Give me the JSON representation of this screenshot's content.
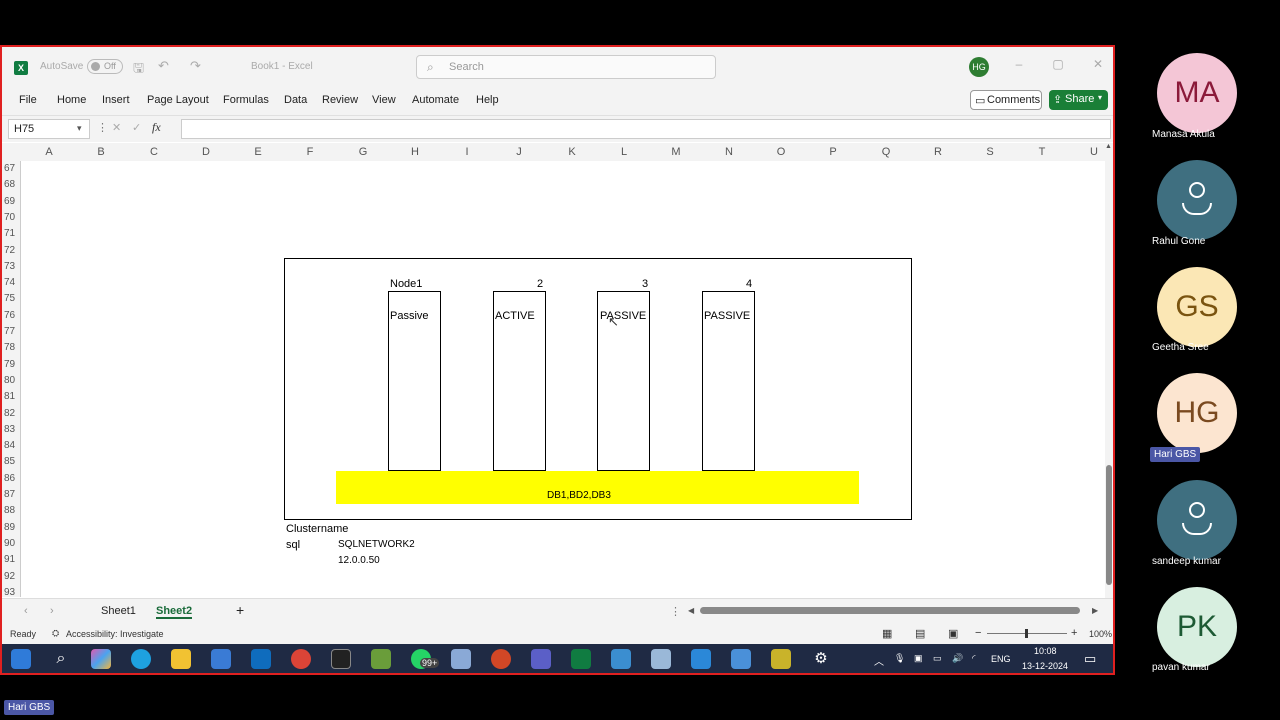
{
  "excel": {
    "autosave_label": "AutoSave",
    "autosave_state": "Off",
    "doc_title": "Book1 - Excel",
    "search_placeholder": "Search",
    "user_initials": "HG",
    "tabs": [
      "File",
      "Home",
      "Insert",
      "Page Layout",
      "Formulas",
      "Data",
      "Review",
      "View",
      "Automate",
      "Help"
    ],
    "comments_label": "Comments",
    "share_label": "Share",
    "name_box": "H75",
    "fx_label": "fx",
    "columns": [
      "A",
      "B",
      "C",
      "D",
      "E",
      "F",
      "G",
      "H",
      "I",
      "J",
      "K",
      "L",
      "M",
      "N",
      "O",
      "P",
      "Q",
      "R",
      "S",
      "T",
      "U"
    ],
    "rows": [
      "67",
      "68",
      "69",
      "70",
      "71",
      "72",
      "73",
      "74",
      "75",
      "76",
      "77",
      "78",
      "79",
      "80",
      "81",
      "82",
      "83",
      "84",
      "85",
      "86",
      "87",
      "88",
      "89",
      "90",
      "91",
      "92",
      "93"
    ],
    "diagram": {
      "node1_label": "Node1",
      "node2_label": "2",
      "node3_label": "3",
      "node4_label": "4",
      "node1_state": "Passive",
      "node2_state": "ACTIVE",
      "node3_state": "PASSIVE",
      "node4_state": "PASSIVE",
      "storage_label": "DB1,BD2,DB3",
      "storage_color": "#ffff00"
    },
    "cells": {
      "clustername": "Clustername",
      "sql": "sql",
      "network": "SQLNETWORK2",
      "ip": "12.0.0.50"
    },
    "sheets": [
      "Sheet1",
      "Sheet2"
    ],
    "active_sheet": "Sheet2",
    "status_ready": "Ready",
    "status_accessibility": "Accessibility: Investigate",
    "zoom": "100%"
  },
  "taskbar": {
    "badge": "99+",
    "lang": "ENG",
    "time": "10:08",
    "date": "13-12-2024"
  },
  "participants": [
    {
      "initials": "MA",
      "name": "Manasa Akula",
      "bg": "#f4c6d6",
      "fg": "#8b1a3a"
    },
    {
      "initials": "",
      "name": "Rahul Gone",
      "bg": "#3f6f80",
      "fg": "#ffffff"
    },
    {
      "initials": "GS",
      "name": "Geetha Sree",
      "bg": "#fbe7b5",
      "fg": "#7a5410"
    },
    {
      "initials": "HG",
      "name": "Hari GBS",
      "bg": "#fce5d0",
      "fg": "#7a4a20"
    },
    {
      "initials": "",
      "name": "sandeep kumar",
      "bg": "#3f6f80",
      "fg": "#ffffff"
    },
    {
      "initials": "PK",
      "name": "pavan kumar",
      "bg": "#d8efe0",
      "fg": "#1d5a34"
    }
  ],
  "bottom_label": "Hari GBS"
}
